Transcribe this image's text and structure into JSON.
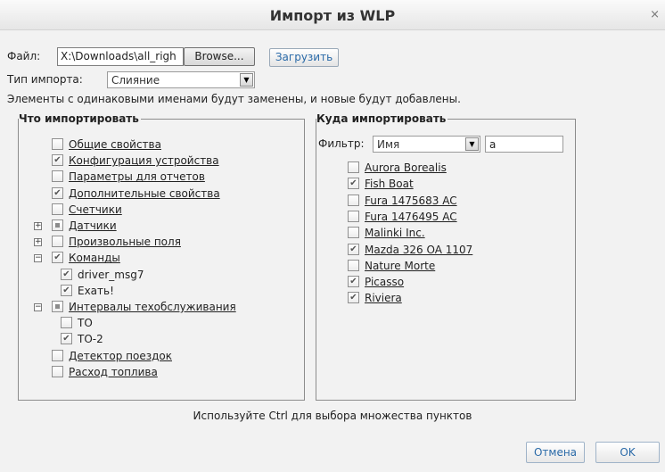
{
  "dialog": {
    "title": "Импорт из WLP",
    "close_glyph": "×"
  },
  "file": {
    "label": "Файл:",
    "value": "X:\\Downloads\\all_righ",
    "browse_label": "Browse...",
    "load_label": "Загрузить"
  },
  "import_type": {
    "label": "Тип импорта:",
    "selected": "Слияние"
  },
  "info_text": "Элементы с одинаковыми именами будут заменены, и новые будут добавлены.",
  "what": {
    "title": "Что импортировать",
    "items": [
      {
        "label": "Общие свойства",
        "checked": false
      },
      {
        "label": "Конфигурация устройства",
        "checked": true
      },
      {
        "label": "Параметры для отчетов",
        "checked": false
      },
      {
        "label": "Дополнительные свойства",
        "checked": true
      },
      {
        "label": "Счетчики",
        "checked": false
      },
      {
        "label": "Датчики",
        "state": "partial",
        "expander": "+"
      },
      {
        "label": "Произвольные поля",
        "checked": false,
        "expander": "+"
      },
      {
        "label": "Команды",
        "checked": true,
        "expander": "−"
      },
      {
        "label": "driver_msg7",
        "checked": true
      },
      {
        "label": "Ехать!",
        "checked": true
      },
      {
        "label": "Интервалы техобслуживания",
        "state": "partial",
        "expander": "−"
      },
      {
        "label": "ТО",
        "checked": false
      },
      {
        "label": "ТО-2",
        "checked": true
      },
      {
        "label": "Детектор поездок",
        "checked": false
      },
      {
        "label": "Расход топлива",
        "checked": false
      }
    ]
  },
  "where": {
    "title": "Куда импортировать",
    "filter_label": "Фильтр:",
    "filter_field": "Имя",
    "filter_text": "a",
    "units": [
      {
        "label": "Aurora Borealis",
        "checked": false
      },
      {
        "label": "Fish Boat",
        "checked": true
      },
      {
        "label": "Fura 1475683 AC",
        "checked": false
      },
      {
        "label": "Fura 1476495 AC",
        "checked": false
      },
      {
        "label": "Malinki Inc.",
        "checked": false
      },
      {
        "label": "Mazda 326 OA 1107",
        "checked": true
      },
      {
        "label": "Nature Morte",
        "checked": false
      },
      {
        "label": "Picasso",
        "checked": true
      },
      {
        "label": "Riviera",
        "checked": true
      }
    ]
  },
  "hint": "Используйте Ctrl для выбора множества пунктов",
  "buttons": {
    "cancel": "Отмена",
    "ok": "OK"
  },
  "check_glyph": "✔",
  "select_arrow_glyph": "▼"
}
